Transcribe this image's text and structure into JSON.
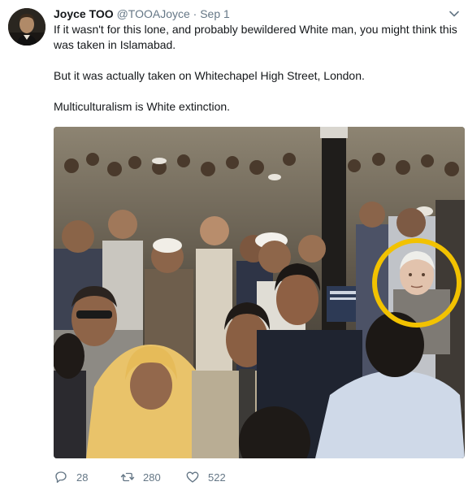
{
  "tweet": {
    "author": {
      "display_name": "Joyce TOO",
      "handle": "@TOOAJoyce",
      "separator": "·",
      "date": "Sep 1"
    },
    "menu_icon": "chevron-down-icon",
    "paragraphs": [
      "If it wasn't for this lone, and probably bewildered White man, you might think this was taken in Islamabad.",
      "But it was actually taken on Whitechapel High Street, London.",
      "Multiculturalism is White extinction."
    ],
    "media": {
      "type": "photo",
      "highlight_color": "#f2c200"
    },
    "actions": {
      "reply": {
        "icon": "reply-icon",
        "count": "28"
      },
      "retweet": {
        "icon": "retweet-icon",
        "count": "280"
      },
      "like": {
        "icon": "heart-icon",
        "count": "522"
      }
    }
  },
  "colors": {
    "text_primary": "#14171a",
    "text_secondary": "#657786"
  }
}
